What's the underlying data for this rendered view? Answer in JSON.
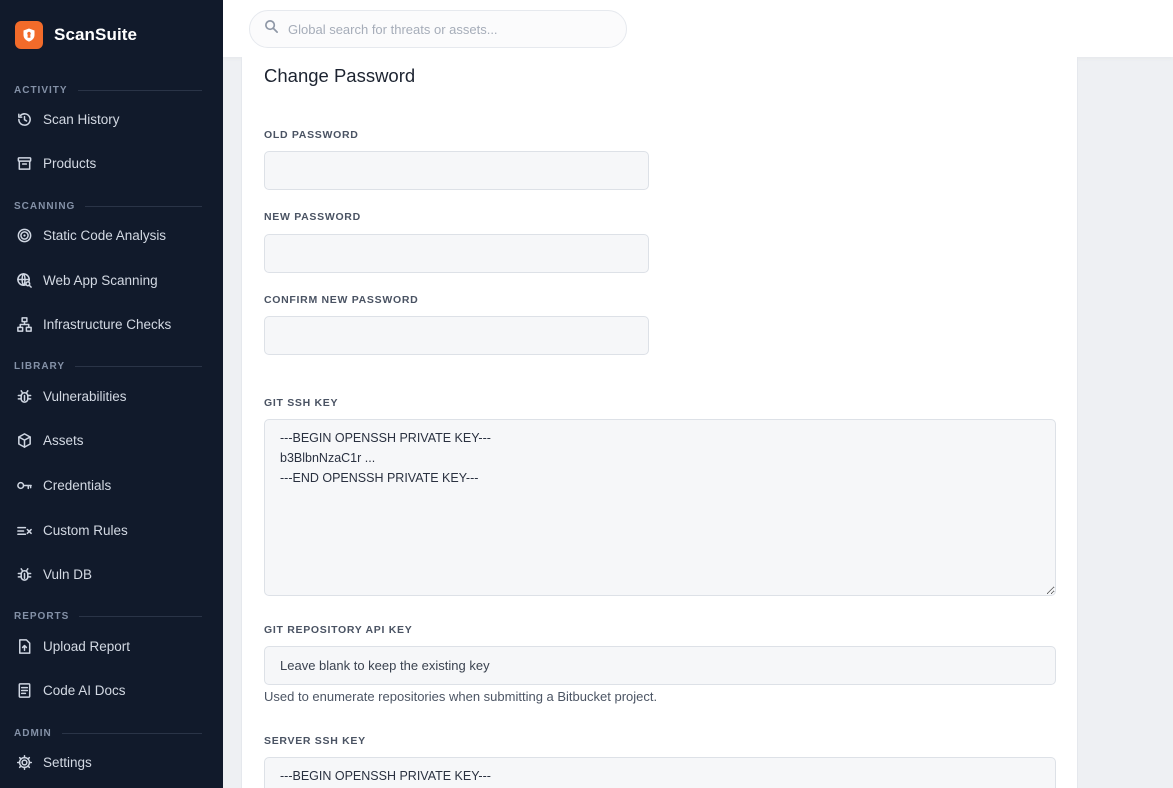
{
  "brand": {
    "name": "ScanSuite",
    "accent": "#f26b2a"
  },
  "search": {
    "placeholder": "Global search for threats or assets..."
  },
  "sidebar": {
    "sections": [
      {
        "label": "ACTIVITY",
        "items": [
          {
            "label": "Scan History",
            "icon": "history-icon"
          },
          {
            "label": "Products",
            "icon": "archive-box-icon"
          }
        ]
      },
      {
        "label": "SCANNING",
        "items": [
          {
            "label": "Static Code Analysis",
            "icon": "target-icon"
          },
          {
            "label": "Web App Scanning",
            "icon": "globe-search-icon"
          },
          {
            "label": "Infrastructure Checks",
            "icon": "network-tree-icon"
          }
        ]
      },
      {
        "label": "LIBRARY",
        "items": [
          {
            "label": "Vulnerabilities",
            "icon": "bug-icon"
          },
          {
            "label": "Assets",
            "icon": "cube-icon"
          },
          {
            "label": "Credentials",
            "icon": "key-icon"
          },
          {
            "label": "Custom Rules",
            "icon": "rules-icon"
          },
          {
            "label": "Vuln DB",
            "icon": "bug-icon"
          }
        ]
      },
      {
        "label": "REPORTS",
        "items": [
          {
            "label": "Upload Report",
            "icon": "upload-file-icon"
          },
          {
            "label": "Code AI Docs",
            "icon": "document-icon"
          }
        ]
      },
      {
        "label": "ADMIN",
        "items": [
          {
            "label": "Settings",
            "icon": "gear-icon"
          }
        ]
      }
    ]
  },
  "form": {
    "title": "Change Password",
    "old_password": {
      "label": "OLD PASSWORD",
      "value": ""
    },
    "new_password": {
      "label": "NEW PASSWORD",
      "value": ""
    },
    "confirm_password": {
      "label": "CONFIRM NEW PASSWORD",
      "value": ""
    },
    "git_ssh_key": {
      "label": "GIT SSH KEY",
      "value": "---BEGIN OPENSSH PRIVATE KEY---\nb3BlbnNzaC1r ...\n---END OPENSSH PRIVATE KEY---"
    },
    "git_api_key": {
      "label": "GIT REPOSITORY API KEY",
      "placeholder": "Leave blank to keep the existing key",
      "help": "Used to enumerate repositories when submitting a Bitbucket project."
    },
    "server_ssh_key": {
      "label": "SERVER SSH KEY",
      "value": "---BEGIN OPENSSH PRIVATE KEY---"
    }
  }
}
